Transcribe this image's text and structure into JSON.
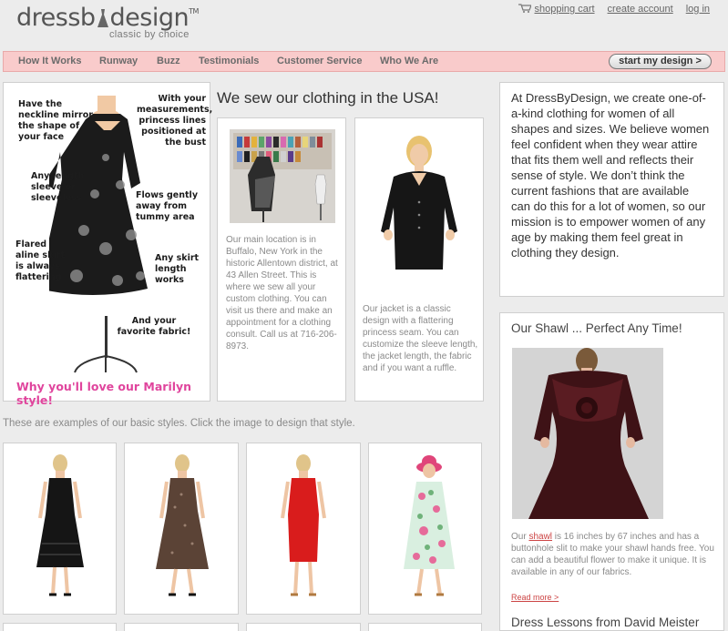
{
  "brand": {
    "name_left": "dressb",
    "name_right": "design",
    "tm": "TM",
    "tagline": "classic by choice"
  },
  "toplinks": {
    "cart": "shopping cart",
    "account": "create account",
    "login": "log in"
  },
  "nav": {
    "items": [
      "How It Works",
      "Runway",
      "Buzz",
      "Testimonials",
      "Customer Service",
      "Who We Are"
    ],
    "cta": "start my design >"
  },
  "mannequin": {
    "notes": [
      "Have the neckline mirror the shape of your face",
      "With your measurements, princess lines positioned at the bust",
      "Any length sleeve or sleeveless",
      "Flows gently away from tummy area",
      "Flared aline skirt is always flattering",
      "Any skirt length works",
      "And your favorite fabric!"
    ],
    "tagline": "Why you'll love our Marilyn style!"
  },
  "usa": {
    "title": "We sew our clothing in the USA!",
    "location_text": "Our main location is in Buffalo, New York in the historic Allentown district, at 43 Allen Street. This is where we sew all your custom clothing. You can visit us there and make an appointment for a clothing consult. Call us at 716-206-8973.",
    "jacket_text": "Our jacket is a classic design with a flattering princess seam. You can customize the sleeve length, the jacket length, the fabric and if you want a ruffle."
  },
  "about": {
    "text": "At DressByDesign, we create one-of-a-kind clothing for women of all shapes and sizes. We believe women feel confident when they wear attire that fits them well and reflects their sense of style. We don’t think the current fashions that are available can do this for a lot of women, so our mission is to empower women of any age by making them feel great in clothing they design."
  },
  "shawl": {
    "title": "Our Shawl ... Perfect Any Time!",
    "text_before": "Our ",
    "link": "shawl",
    "text_after": " is 16 inches by 67 inches and has a buttonhole slit to make your shawl hands free. You can add a beautiful flower to make it unique. It is available in any of our fabrics.",
    "read_more": "Read more >"
  },
  "lessons": {
    "title": "Dress Lessons from David Meister"
  },
  "examples": {
    "text": "These are examples of our basic styles. Click the image to design that style."
  },
  "colors": {
    "nav_bg": "#f9cbcb",
    "accent_pink": "#e0459d",
    "link_red": "#c44"
  }
}
